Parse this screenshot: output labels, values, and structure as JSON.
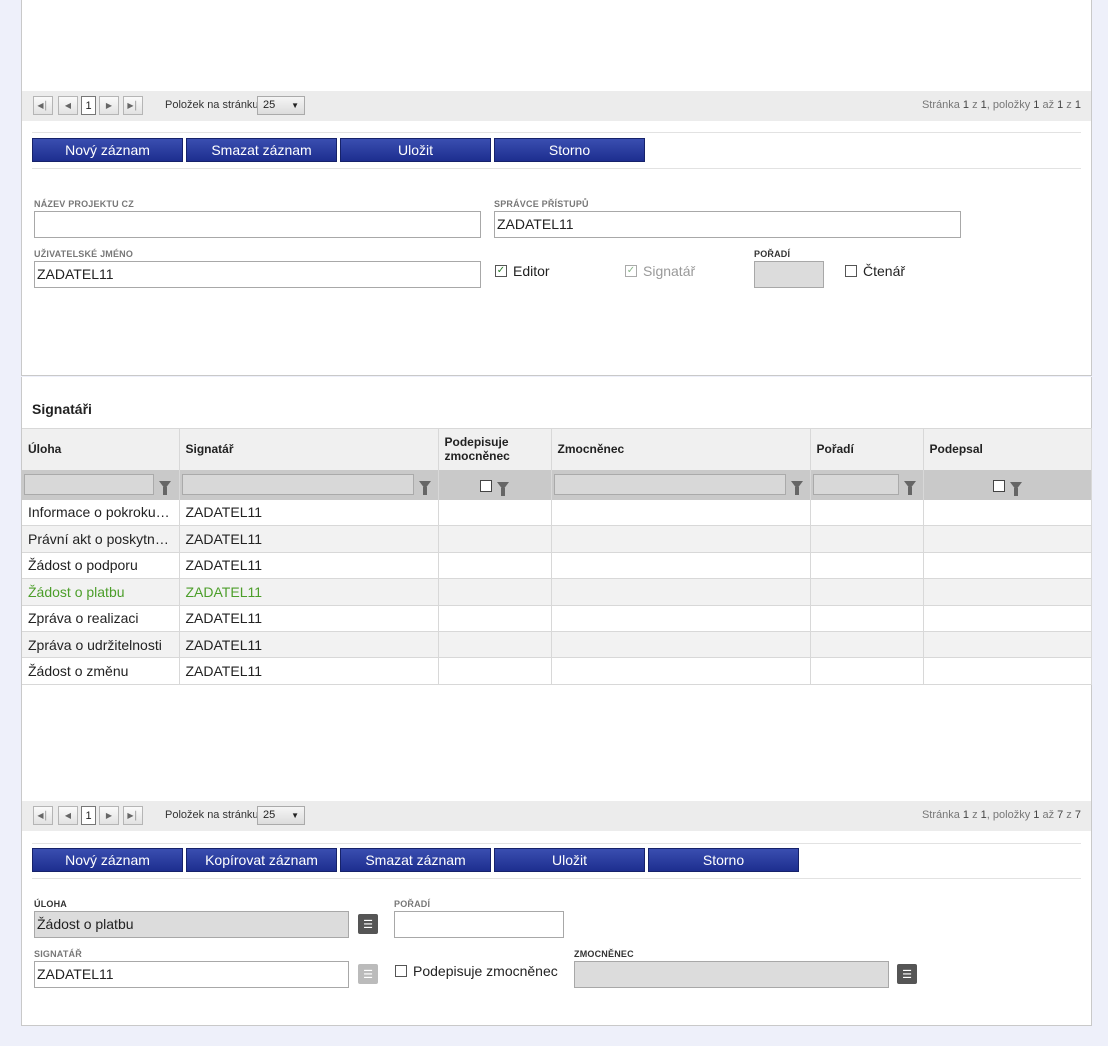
{
  "pager_top": {
    "page": "1",
    "per_page_label": "Položek na stránku",
    "per_page": "25",
    "info_prefix": "Stránka ",
    "page_num": "1",
    "z1": " z ",
    "page_total": "1",
    "mid": ", položky ",
    "from": "1",
    "az": " až ",
    "to": "1",
    "z2": " z ",
    "total": "1"
  },
  "toolbar_top": {
    "new": "Nový záznam",
    "delete": "Smazat záznam",
    "save": "Uložit",
    "cancel": "Storno"
  },
  "form_top": {
    "project_name_label": "NÁZEV PROJEKTU CZ",
    "project_name_value": "",
    "access_admin_label": "SPRÁVCE PŘÍSTUPŮ",
    "access_admin_value": "ZADATEL11",
    "username_label": "UŽIVATELSKÉ JMÉNO",
    "username_value": "ZADATEL11",
    "editor_label": "Editor",
    "signatory_label": "Signatář",
    "order_label": "POŘADÍ",
    "order_value": "",
    "reader_label": "Čtenář"
  },
  "signatories": {
    "title": "Signatáři",
    "columns": [
      "Úloha",
      "Signatář",
      "Podepisuje zmocněnec",
      "Zmocněnec",
      "Pořadí",
      "Podepsal"
    ],
    "rows": [
      {
        "task": "Informace o pokroku v realizaci",
        "signatory": "ZADATEL11"
      },
      {
        "task": "Právní akt o poskytnutí/převodu podpory",
        "signatory": "ZADATEL11"
      },
      {
        "task": "Žádost o podporu",
        "signatory": "ZADATEL11"
      },
      {
        "task": "Žádost o platbu",
        "signatory": "ZADATEL11"
      },
      {
        "task": "Zpráva o realizaci",
        "signatory": "ZADATEL11"
      },
      {
        "task": "Zpráva o udržitelnosti",
        "signatory": "ZADATEL11"
      },
      {
        "task": "Žádost o změnu",
        "signatory": "ZADATEL11"
      }
    ]
  },
  "pager_bottom": {
    "page": "1",
    "per_page_label": "Položek na stránku",
    "per_page": "25",
    "info_prefix": "Stránka ",
    "page_num": "1",
    "z1": " z ",
    "page_total": "1",
    "mid": ", položky ",
    "from": "1",
    "az": " až ",
    "to": "7",
    "z2": " z ",
    "total": "7"
  },
  "toolbar_bottom": {
    "new": "Nový záznam",
    "copy": "Kopírovat záznam",
    "delete": "Smazat záznam",
    "save": "Uložit",
    "cancel": "Storno"
  },
  "form_bottom": {
    "task_label": "ÚLOHA",
    "task_value": "Žádost o platbu",
    "order_label": "POŘADÍ",
    "order_value": "",
    "signatory_label": "SIGNATÁŘ",
    "signatory_value": "ZADATEL11",
    "proxy_signs_label": "Podepisuje zmocněnec",
    "proxy_label": "ZMOCNĚNEC",
    "proxy_value": ""
  },
  "colors": {
    "button": "#1d2e8f",
    "selected_row_text": "#4c9e2a",
    "background": "#eef0fa"
  }
}
